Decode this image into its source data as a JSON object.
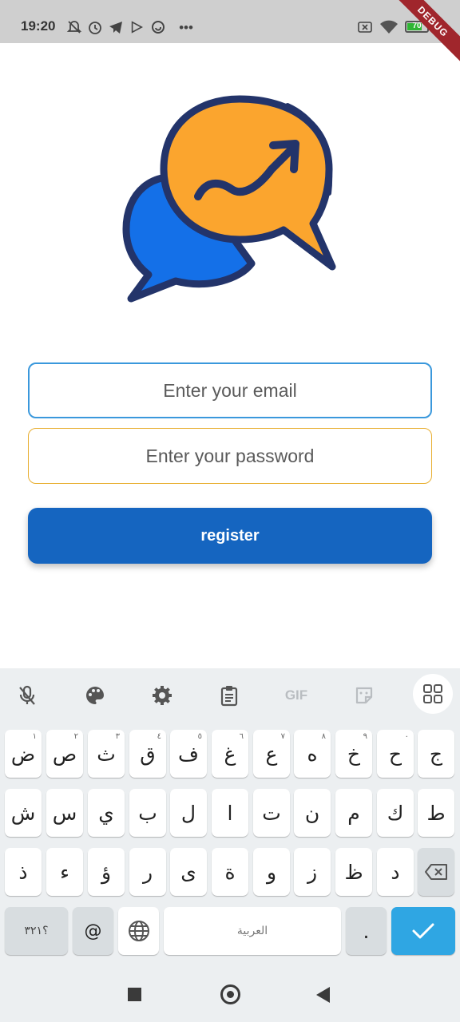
{
  "status_bar": {
    "time": "19:20",
    "more_icons": "•••",
    "battery_level": "70",
    "battery_fraction": 0.7,
    "debug_banner": "DEBUG",
    "icons": [
      "bell-off-icon",
      "alarm-icon",
      "telegram-icon",
      "play-icon",
      "sync-icon",
      "more-icon",
      "sim-off-icon",
      "wifi-icon",
      "battery-icon"
    ]
  },
  "logo": {
    "icon": "chat-bubbles-trend-logo",
    "colors": {
      "outline": "#23346a",
      "orange": "#fba52e",
      "blue": "#1470e8"
    }
  },
  "form": {
    "email_placeholder": "Enter your email",
    "email_value": "",
    "password_placeholder": "Enter your password",
    "password_value": "",
    "register_label": "register",
    "colors": {
      "email_border": "#3a98dc",
      "password_border": "#e8ae2f",
      "button": "#1565c0"
    }
  },
  "keyboard": {
    "toolbar_icons": [
      "mic-off-icon",
      "palette-icon",
      "settings-icon",
      "clipboard-icon",
      "gif-icon",
      "sticker-icon",
      "grid-icon"
    ],
    "gif_label": "GIF",
    "row1": [
      {
        "char": "ض",
        "hint": "١"
      },
      {
        "char": "ص",
        "hint": "٢"
      },
      {
        "char": "ث",
        "hint": "٣"
      },
      {
        "char": "ق",
        "hint": "٤"
      },
      {
        "char": "ف",
        "hint": "٥"
      },
      {
        "char": "غ",
        "hint": "٦"
      },
      {
        "char": "ع",
        "hint": "٧"
      },
      {
        "char": "ه",
        "hint": "٨"
      },
      {
        "char": "خ",
        "hint": "٩"
      },
      {
        "char": "ح",
        "hint": "٠"
      },
      {
        "char": "ج",
        "hint": ""
      }
    ],
    "row2": [
      "ش",
      "س",
      "ي",
      "ب",
      "ل",
      "ا",
      "ت",
      "ن",
      "م",
      "ك",
      "ط"
    ],
    "row3": [
      "ذ",
      "ء",
      "ؤ",
      "ر",
      "ى",
      "ة",
      "و",
      "ز",
      "ظ",
      "د"
    ],
    "symbols_label": "؟٣٢١",
    "at_label": "@",
    "space_label": "العربية",
    "period_label": ".",
    "accent_color": "#2fa6e3"
  },
  "nav_bar": {
    "icons": [
      "recents-icon",
      "home-icon",
      "back-icon"
    ]
  }
}
